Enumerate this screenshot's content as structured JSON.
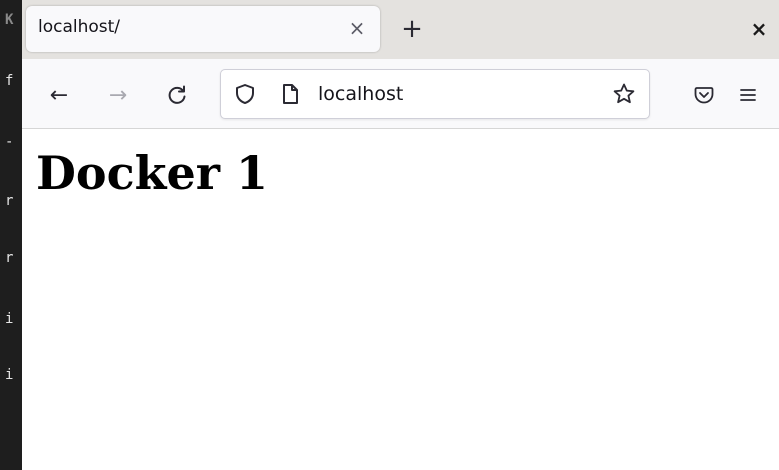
{
  "terminal": {
    "lines": [
      {
        "text": "K",
        "dim": true
      },
      {
        "text": "f",
        "dim": false
      },
      {
        "text": "-",
        "dim": false
      },
      {
        "text": "r",
        "dim": false
      },
      {
        "text": "r",
        "dim": false
      },
      {
        "text": "i",
        "dim": false
      },
      {
        "text": "i",
        "dim": false
      }
    ]
  },
  "browser": {
    "tab": {
      "title": "localhost/",
      "close_glyph": "×"
    },
    "new_tab_glyph": "+",
    "window_close_glyph": "×",
    "nav": {
      "back_glyph": "←",
      "forward_glyph": "→",
      "reload_glyph": "C"
    },
    "urlbar": {
      "url": "localhost",
      "icons": [
        "shield-icon",
        "page-icon",
        "star-icon"
      ]
    },
    "toolbar_icons": [
      "pocket-icon",
      "hamburger-menu-icon"
    ],
    "page": {
      "heading": "Docker 1"
    }
  }
}
